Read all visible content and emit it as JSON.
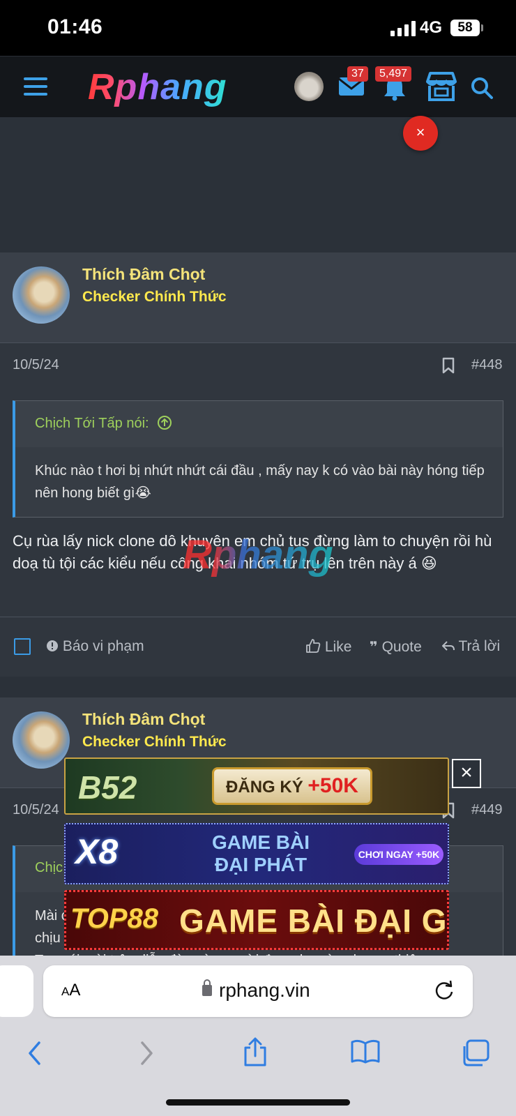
{
  "status_bar": {
    "time": "01:46",
    "network": "4G",
    "battery": "58"
  },
  "header": {
    "logo_text": "Rphang",
    "messages_badge": "37",
    "alerts_badge": "5,497"
  },
  "ad": {
    "close_label": "×"
  },
  "posts": [
    {
      "username": "Thích Đâm Chọt",
      "user_title": "Checker Chính Thức",
      "date": "10/5/24",
      "post_number": "#448",
      "quote_author": "Chịch Tới Tấp nói:",
      "quote_text": "Khúc nào t hơi bị nhứt nhứt cái đầu , mấy nay k có vào bài này hóng tiếp nên hong biết gì😭",
      "body": "Cụ rùa lấy nick clone dô khuyên em chủ tus đừng làm to chuyện rồi hù doạ tù tội các kiểu nếu công khai nhóm tứ trụ lên trên này á 😆",
      "actions": {
        "report": "Báo vi phạm",
        "like": "Like",
        "quote": "Quote",
        "reply": "Trả lời"
      }
    },
    {
      "username": "Thích Đâm Chọt",
      "user_title": "Checker Chính Thức",
      "date": "10/5/24",
      "post_number": "#449",
      "quote_author": "Chịc",
      "quote_text": "Mài c",
      "body_line2": "chịu",
      "body_line3": "Tao nói mài trên diễn đàn này người được ba cùng lương thiện"
    }
  ],
  "watermark": "Rphang",
  "banners": {
    "b52": {
      "logo": "B52",
      "cta": "ĐĂNG KÝ",
      "bonus": "+50K"
    },
    "x8": {
      "logo": "X8",
      "title_line1": "GAME BÀI",
      "title_line2": "ĐẠI PHÁT",
      "button": "CHƠI NGAY +50K"
    },
    "top88": {
      "logo": "TOP88",
      "text": "GAME BÀI ĐẠI GIA"
    },
    "close_label": "×"
  },
  "safari": {
    "text_size": "AA",
    "url": "rphang.vin"
  }
}
